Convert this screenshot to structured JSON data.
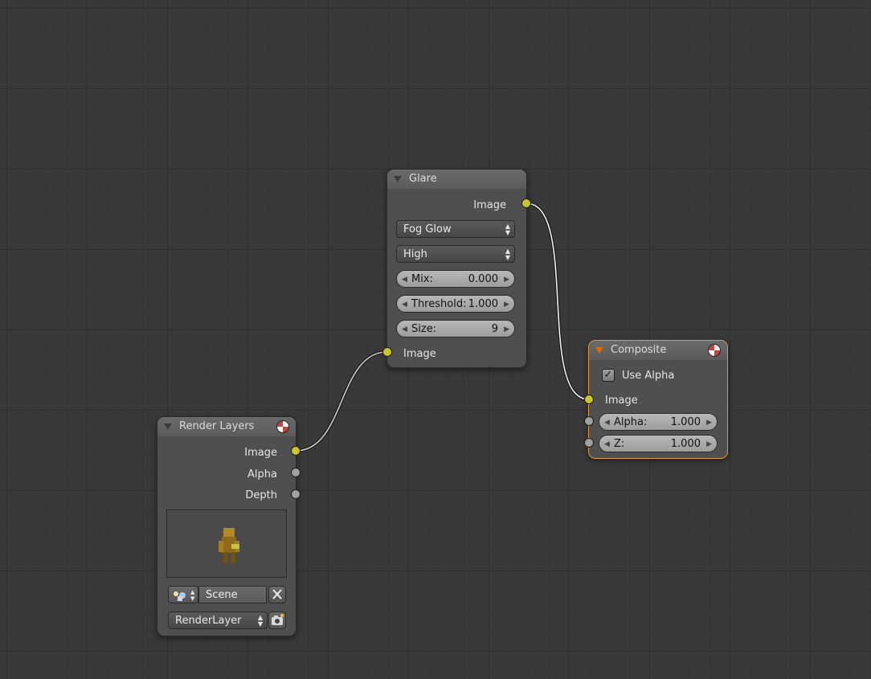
{
  "colors": {
    "background": "#393939",
    "node_body": "#4f4f4f",
    "node_header": "#636363",
    "image_socket": "#c7c72a",
    "value_socket": "#a1a1a1",
    "active_outline": "#e09a3c",
    "link": "#d8d8d8"
  },
  "glare": {
    "title": "Glare",
    "output_image": "Image",
    "glare_type": "Fog Glow",
    "quality": "High",
    "mix_label": "Mix:",
    "mix_value": "0.000",
    "threshold_label": "Threshold:",
    "threshold_value": "1.000",
    "size_label": "Size:",
    "size_value": "9",
    "input_image": "Image"
  },
  "composite": {
    "title": "Composite",
    "use_alpha_label": "Use Alpha",
    "use_alpha_checked": true,
    "input_image": "Image",
    "alpha_label": "Alpha:",
    "alpha_value": "1.000",
    "z_label": "Z:",
    "z_value": "1.000"
  },
  "render_layers": {
    "title": "Render Layers",
    "output_image": "Image",
    "output_alpha": "Alpha",
    "output_depth": "Depth",
    "scene_name": "Scene",
    "layer_name": "RenderLayer"
  },
  "icons": {
    "collapse": "triangle-down-icon",
    "preview": "preview-sphere-icon",
    "scene_browse": "scene-browse-icon",
    "clear": "x-icon",
    "render": "camera-icon",
    "check": "checkmark-icon"
  }
}
